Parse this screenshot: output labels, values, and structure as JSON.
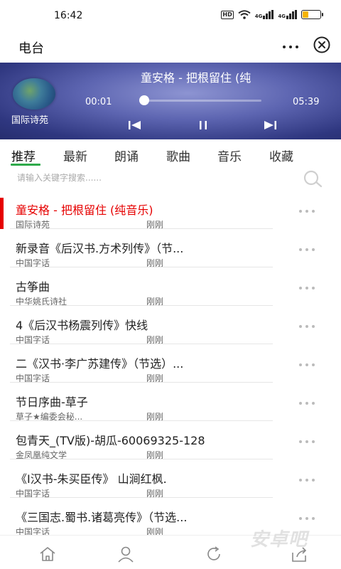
{
  "status": {
    "time": "16:42",
    "hd": "HD",
    "net1": "4G",
    "net2": "4G",
    "battery_level": 0.35,
    "battery_color": "#f5b400"
  },
  "header": {
    "title": "电台",
    "more_icon": "more-dots-icon",
    "close_icon": "close-circle-icon"
  },
  "player": {
    "track_title": "童安格 - 把根留住 (纯",
    "station": "国际诗苑",
    "current_time": "00:01",
    "total_time": "05:39",
    "progress": 0.003,
    "background_color": "#4b529e"
  },
  "tabs": [
    {
      "label": "推荐",
      "active": true
    },
    {
      "label": "最新"
    },
    {
      "label": "朗诵"
    },
    {
      "label": "歌曲"
    },
    {
      "label": "音乐"
    },
    {
      "label": "收藏"
    }
  ],
  "search": {
    "placeholder": "请输入关键字搜索......"
  },
  "list": [
    {
      "title": "童安格 - 把根留住 (纯音乐)",
      "source": "国际诗苑",
      "time": "刚刚",
      "active": true
    },
    {
      "title": "新录音《后汉书.方术列传》（节...",
      "source": "中国字话",
      "time": "刚刚"
    },
    {
      "title": "古筝曲",
      "source": "中华姚氏诗社",
      "time": "刚刚"
    },
    {
      "title": "4《后汉书杨震列传》快线",
      "source": "中国字话",
      "time": "刚刚"
    },
    {
      "title": "二《汉书·李广苏建传》（节选）...",
      "source": "中国字话",
      "time": "刚刚"
    },
    {
      "title": "节日序曲-草子",
      "source": "草子★编委会秘...",
      "time": "刚刚"
    },
    {
      "title": "包青天_(TV版)-胡瓜-60069325-128",
      "source": "金凤凰纯文学",
      "time": "刚刚"
    },
    {
      "title": "《I汉书-朱买臣传》 山涧红枫.",
      "source": "中国字话",
      "time": "刚刚"
    },
    {
      "title": "《三国志.蜀书.诸葛亮传》（节选...",
      "source": "中国字话",
      "time": "刚刚"
    }
  ],
  "bottom_nav": [
    "home-icon",
    "user-icon",
    "refresh-icon",
    "share-icon"
  ],
  "accent_color": "#e60000",
  "tab_indicator_color": "#2eaa4a",
  "watermark": "安卓吧"
}
